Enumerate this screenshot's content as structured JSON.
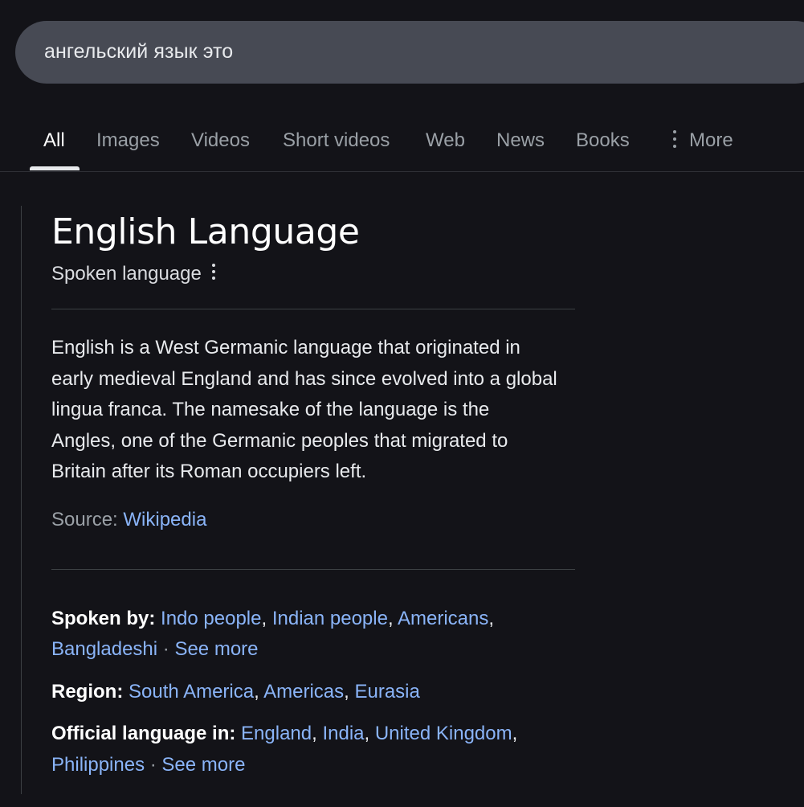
{
  "search": {
    "query": "ангельский язык это"
  },
  "tabs": [
    {
      "label": "All"
    },
    {
      "label": "Images"
    },
    {
      "label": "Videos"
    },
    {
      "label": "Short videos"
    },
    {
      "label": "Web"
    },
    {
      "label": "News"
    },
    {
      "label": "Books"
    },
    {
      "label": "More"
    }
  ],
  "panel": {
    "title": "English Language",
    "subtitle": "Spoken language",
    "description_lines": [
      "English is a West Germanic language that originated in",
      "early medieval England and has since evolved into a global",
      "lingua franca. The namesake of the language is the",
      "Angles, one of the Germanic peoples that migrated to",
      "Britain after its Roman occupiers left."
    ],
    "source_label": "Source:",
    "source_link": "Wikipedia",
    "facts": {
      "spoken_by": {
        "label": "Spoken by:",
        "links": [
          "Indo people",
          "Indian people",
          "Americans",
          "Bangladeshi"
        ],
        "see_more": "See more"
      },
      "region": {
        "label": "Region:",
        "links": [
          "South America",
          "Americas",
          "Eurasia"
        ]
      },
      "official_language": {
        "label": "Official language in:",
        "links": [
          "England",
          "India",
          "United Kingdom",
          "Philippines"
        ],
        "see_more": "See more"
      }
    }
  }
}
